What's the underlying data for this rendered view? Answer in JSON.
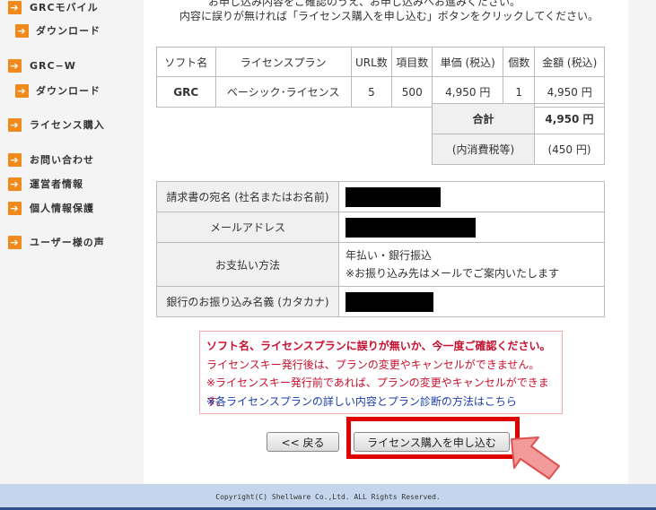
{
  "sidebar": {
    "items": [
      {
        "label": "GRCモバイル",
        "sub": "ダウンロード"
      },
      {
        "label": "GRC−W",
        "sub": "ダウンロード"
      },
      {
        "label": "ライセンス購入"
      },
      {
        "label": "お問い合わせ"
      },
      {
        "label": "運営者情報"
      },
      {
        "label": "個人情報保護"
      },
      {
        "label": "ユーザー様の声"
      }
    ]
  },
  "intro": {
    "cut_text": "お申し込み内容をご確認のうえ、お申し込みへお進みください。",
    "text": "内容に誤りが無ければ「ライセンス購入を申し込む」ボタンをクリックしてください。"
  },
  "order_table": {
    "headers": [
      "ソフト名",
      "ライセンスプラン",
      "URL数",
      "項目数",
      "単価 (税込)",
      "個数",
      "金額 (税込)"
    ],
    "row": [
      "GRC",
      "ベーシック･ライセンス",
      "5",
      "500",
      "4,950 円",
      "1",
      "4,950 円"
    ],
    "total_label": "合計",
    "total_value": "4,950 円",
    "tax_label": "(内消費税等)",
    "tax_value": "(450 円)"
  },
  "info_table": {
    "billing_name_label": "請求書の宛名 (社名またはお名前)",
    "email_label": "メールアドレス",
    "payment_label": "お支払い方法",
    "payment_value": "年払い・銀行振込",
    "payment_note": "※お振り込み先はメールでご案内いたします",
    "transfer_name_label": "銀行のお振り込み名義 (カタカナ)"
  },
  "notice": {
    "title": "ソフト名、ライセンスプランに誤りが無いか、今一度ご確認ください。",
    "line1": "ライセンスキー発行後は、プランの変更やキャンセルができません。",
    "line2": "※ライセンスキー発行前であれば、プランの変更やキャンセルができます。",
    "link": "※各ライセンスプランの詳しい内容とプラン診断の方法はこちら"
  },
  "buttons": {
    "back": "<< 戻る",
    "submit": "ライセンス購入を申し込む"
  },
  "footer": {
    "copyright": "Copyright(C) Shellware Co.,Ltd. ALL Rights Reserved."
  },
  "colors": {
    "accent_orange": "#f08a1c",
    "highlight_red": "#e00000",
    "notice_red": "#c8102e",
    "link_blue": "#1a3ea8",
    "footer_bg": "#c5d6ec"
  },
  "icons": {
    "nav_arrow": "arrow-right-icon",
    "pointer": "pointing-arrow-icon"
  }
}
